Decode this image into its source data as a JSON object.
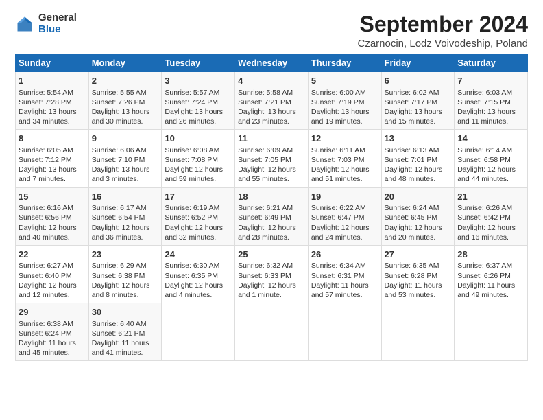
{
  "logo": {
    "general": "General",
    "blue": "Blue"
  },
  "title": "September 2024",
  "location": "Czarnocin, Lodz Voivodeship, Poland",
  "days_of_week": [
    "Sunday",
    "Monday",
    "Tuesday",
    "Wednesday",
    "Thursday",
    "Friday",
    "Saturday"
  ],
  "weeks": [
    [
      {
        "day": "1",
        "sunrise": "Sunrise: 5:54 AM",
        "sunset": "Sunset: 7:28 PM",
        "daylight": "Daylight: 13 hours and 34 minutes."
      },
      {
        "day": "2",
        "sunrise": "Sunrise: 5:55 AM",
        "sunset": "Sunset: 7:26 PM",
        "daylight": "Daylight: 13 hours and 30 minutes."
      },
      {
        "day": "3",
        "sunrise": "Sunrise: 5:57 AM",
        "sunset": "Sunset: 7:24 PM",
        "daylight": "Daylight: 13 hours and 26 minutes."
      },
      {
        "day": "4",
        "sunrise": "Sunrise: 5:58 AM",
        "sunset": "Sunset: 7:21 PM",
        "daylight": "Daylight: 13 hours and 23 minutes."
      },
      {
        "day": "5",
        "sunrise": "Sunrise: 6:00 AM",
        "sunset": "Sunset: 7:19 PM",
        "daylight": "Daylight: 13 hours and 19 minutes."
      },
      {
        "day": "6",
        "sunrise": "Sunrise: 6:02 AM",
        "sunset": "Sunset: 7:17 PM",
        "daylight": "Daylight: 13 hours and 15 minutes."
      },
      {
        "day": "7",
        "sunrise": "Sunrise: 6:03 AM",
        "sunset": "Sunset: 7:15 PM",
        "daylight": "Daylight: 13 hours and 11 minutes."
      }
    ],
    [
      {
        "day": "8",
        "sunrise": "Sunrise: 6:05 AM",
        "sunset": "Sunset: 7:12 PM",
        "daylight": "Daylight: 13 hours and 7 minutes."
      },
      {
        "day": "9",
        "sunrise": "Sunrise: 6:06 AM",
        "sunset": "Sunset: 7:10 PM",
        "daylight": "Daylight: 13 hours and 3 minutes."
      },
      {
        "day": "10",
        "sunrise": "Sunrise: 6:08 AM",
        "sunset": "Sunset: 7:08 PM",
        "daylight": "Daylight: 12 hours and 59 minutes."
      },
      {
        "day": "11",
        "sunrise": "Sunrise: 6:09 AM",
        "sunset": "Sunset: 7:05 PM",
        "daylight": "Daylight: 12 hours and 55 minutes."
      },
      {
        "day": "12",
        "sunrise": "Sunrise: 6:11 AM",
        "sunset": "Sunset: 7:03 PM",
        "daylight": "Daylight: 12 hours and 51 minutes."
      },
      {
        "day": "13",
        "sunrise": "Sunrise: 6:13 AM",
        "sunset": "Sunset: 7:01 PM",
        "daylight": "Daylight: 12 hours and 48 minutes."
      },
      {
        "day": "14",
        "sunrise": "Sunrise: 6:14 AM",
        "sunset": "Sunset: 6:58 PM",
        "daylight": "Daylight: 12 hours and 44 minutes."
      }
    ],
    [
      {
        "day": "15",
        "sunrise": "Sunrise: 6:16 AM",
        "sunset": "Sunset: 6:56 PM",
        "daylight": "Daylight: 12 hours and 40 minutes."
      },
      {
        "day": "16",
        "sunrise": "Sunrise: 6:17 AM",
        "sunset": "Sunset: 6:54 PM",
        "daylight": "Daylight: 12 hours and 36 minutes."
      },
      {
        "day": "17",
        "sunrise": "Sunrise: 6:19 AM",
        "sunset": "Sunset: 6:52 PM",
        "daylight": "Daylight: 12 hours and 32 minutes."
      },
      {
        "day": "18",
        "sunrise": "Sunrise: 6:21 AM",
        "sunset": "Sunset: 6:49 PM",
        "daylight": "Daylight: 12 hours and 28 minutes."
      },
      {
        "day": "19",
        "sunrise": "Sunrise: 6:22 AM",
        "sunset": "Sunset: 6:47 PM",
        "daylight": "Daylight: 12 hours and 24 minutes."
      },
      {
        "day": "20",
        "sunrise": "Sunrise: 6:24 AM",
        "sunset": "Sunset: 6:45 PM",
        "daylight": "Daylight: 12 hours and 20 minutes."
      },
      {
        "day": "21",
        "sunrise": "Sunrise: 6:26 AM",
        "sunset": "Sunset: 6:42 PM",
        "daylight": "Daylight: 12 hours and 16 minutes."
      }
    ],
    [
      {
        "day": "22",
        "sunrise": "Sunrise: 6:27 AM",
        "sunset": "Sunset: 6:40 PM",
        "daylight": "Daylight: 12 hours and 12 minutes."
      },
      {
        "day": "23",
        "sunrise": "Sunrise: 6:29 AM",
        "sunset": "Sunset: 6:38 PM",
        "daylight": "Daylight: 12 hours and 8 minutes."
      },
      {
        "day": "24",
        "sunrise": "Sunrise: 6:30 AM",
        "sunset": "Sunset: 6:35 PM",
        "daylight": "Daylight: 12 hours and 4 minutes."
      },
      {
        "day": "25",
        "sunrise": "Sunrise: 6:32 AM",
        "sunset": "Sunset: 6:33 PM",
        "daylight": "Daylight: 12 hours and 1 minute."
      },
      {
        "day": "26",
        "sunrise": "Sunrise: 6:34 AM",
        "sunset": "Sunset: 6:31 PM",
        "daylight": "Daylight: 11 hours and 57 minutes."
      },
      {
        "day": "27",
        "sunrise": "Sunrise: 6:35 AM",
        "sunset": "Sunset: 6:28 PM",
        "daylight": "Daylight: 11 hours and 53 minutes."
      },
      {
        "day": "28",
        "sunrise": "Sunrise: 6:37 AM",
        "sunset": "Sunset: 6:26 PM",
        "daylight": "Daylight: 11 hours and 49 minutes."
      }
    ],
    [
      {
        "day": "29",
        "sunrise": "Sunrise: 6:38 AM",
        "sunset": "Sunset: 6:24 PM",
        "daylight": "Daylight: 11 hours and 45 minutes."
      },
      {
        "day": "30",
        "sunrise": "Sunrise: 6:40 AM",
        "sunset": "Sunset: 6:21 PM",
        "daylight": "Daylight: 11 hours and 41 minutes."
      },
      null,
      null,
      null,
      null,
      null
    ]
  ]
}
